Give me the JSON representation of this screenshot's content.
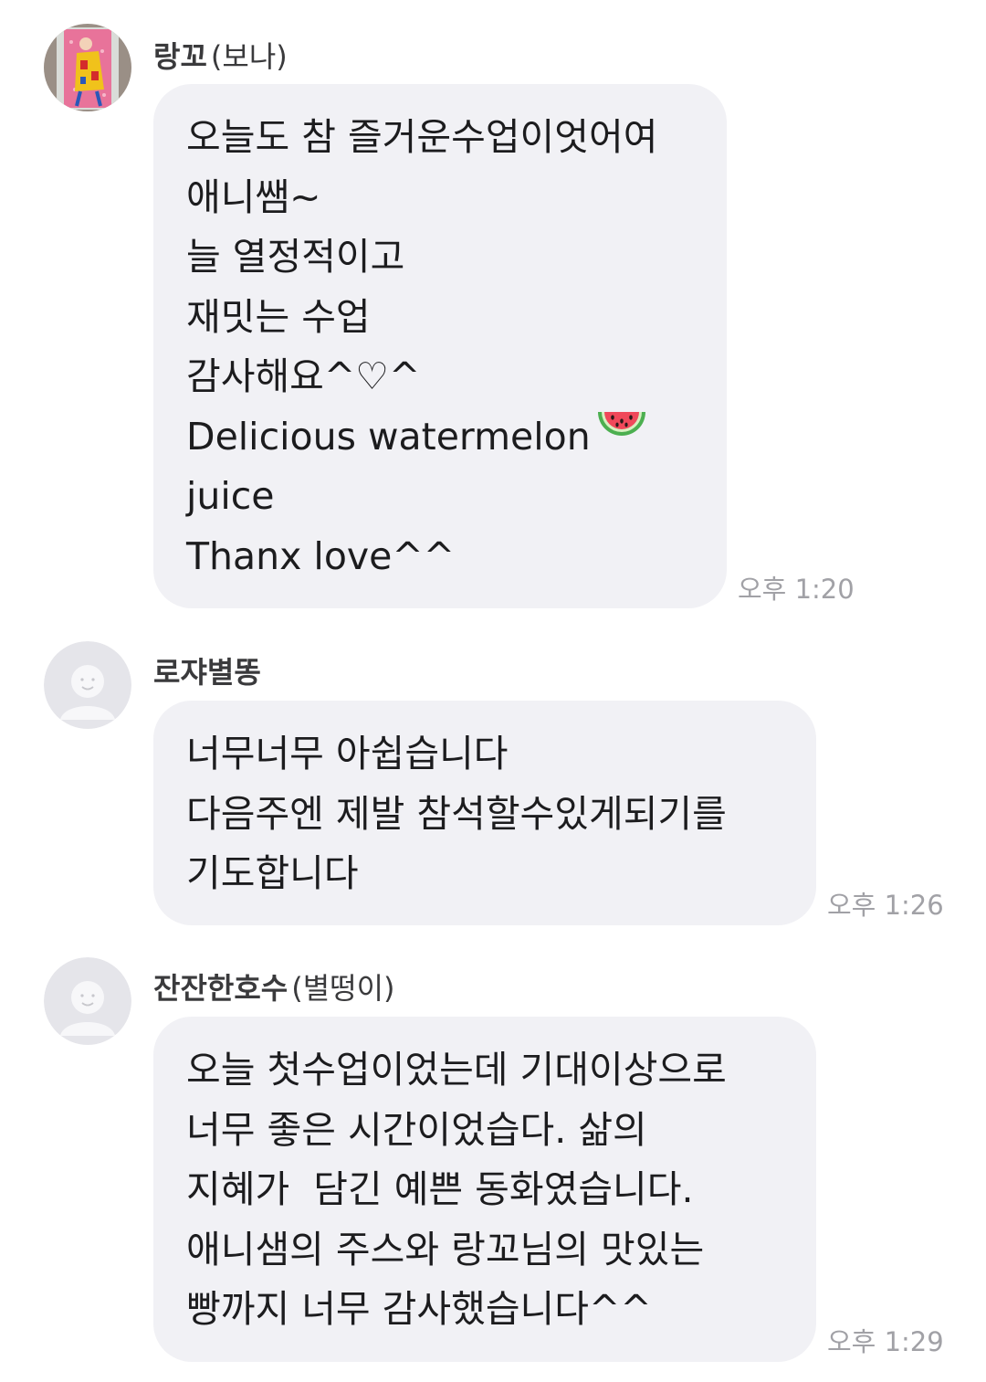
{
  "messages": [
    {
      "sender": "랑꼬",
      "nickname": "(보나)",
      "avatar": "painting-avatar",
      "lines": [
        "오늘도 참 즐거운수업이엇어여",
        "애니쌤~",
        "늘 열정적이고",
        "재밋는 수업",
        "감사해요^♡^",
        "Delicious watermelon",
        "juice",
        "Thanx love^^"
      ],
      "emoji": "watermelon-icon",
      "time": "오후 1:20"
    },
    {
      "sender": "로쟈별똥",
      "nickname": "",
      "avatar": "default-profile-avatar",
      "lines": [
        "너무너무 아쉽습니다",
        "다음주엔 제발 참석할수있게되기를",
        "기도합니다"
      ],
      "time": "오후 1:26"
    },
    {
      "sender": "잔잔한호수",
      "nickname": "(별떵이)",
      "avatar": "default-profile-avatar",
      "lines": [
        "오늘 첫수업이었는데 기대이상으로",
        "너무 좋은 시간이었습다. 삶의",
        "지혜가  담긴 예쁜 동화였습니다.",
        "애니샘의 주스와 랑꼬님의 맛있는",
        "빵까지 너무 감사했습니다^^"
      ],
      "time": "오후 1:29"
    }
  ],
  "colors": {
    "bubble": "#f1f1f5",
    "timestamp": "#a1a1a6",
    "text": "#1c1c1e",
    "default_avatar_bg": "#e5e5ea"
  }
}
